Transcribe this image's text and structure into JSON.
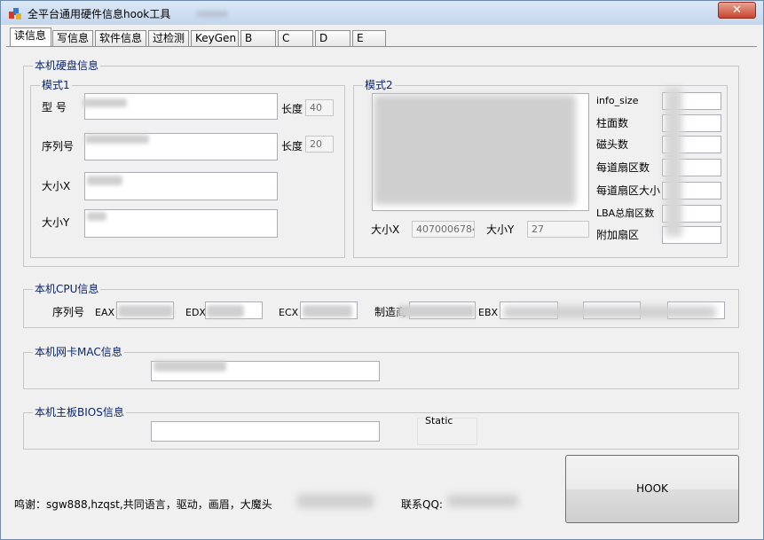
{
  "window": {
    "title": "全平台通用硬件信息hook工具",
    "close_glyph": "✕"
  },
  "tabs": [
    {
      "label": "读信息",
      "active": true
    },
    {
      "label": "写信息"
    },
    {
      "label": "软件信息"
    },
    {
      "label": "过检测"
    },
    {
      "label": "KeyGen"
    },
    {
      "label": "B"
    },
    {
      "label": "C"
    },
    {
      "label": "D"
    },
    {
      "label": "E"
    }
  ],
  "disk": {
    "title": "本机硬盘信息",
    "mode1": {
      "title": "模式1",
      "model_label": "型 号",
      "serial_label": "序列号",
      "size_x_label": "大小X",
      "size_y_label": "大小Y",
      "length_label": "长度",
      "model_length": "40",
      "serial_length": "20"
    },
    "mode2": {
      "title": "模式2",
      "size_x_label": "大小X",
      "size_x_value": "4070006784",
      "size_y_label": "大小Y",
      "size_y_value": "27",
      "fields": [
        "info_size",
        "柱面数",
        "磁头数",
        "每道扇区数",
        "每道扇区大小",
        "LBA总扇区数",
        "附加扇区"
      ]
    }
  },
  "cpu": {
    "title": "本机CPU信息",
    "serial_label": "序列号",
    "eax_label": "EAX",
    "edx_label": "EDX",
    "ecx_label": "ECX",
    "vendor_label": "制造商",
    "ebx_label": "EBX"
  },
  "mac": {
    "title": "本机网卡MAC信息"
  },
  "bios": {
    "title": "本机主板BIOS信息",
    "static_label": "Static"
  },
  "footer": {
    "thanks": "鸣谢：sgw888,hzqst,共同语言，驱动，画眉，大魔头",
    "qq_label": "联系QQ:"
  },
  "hook_button": "HOOK"
}
